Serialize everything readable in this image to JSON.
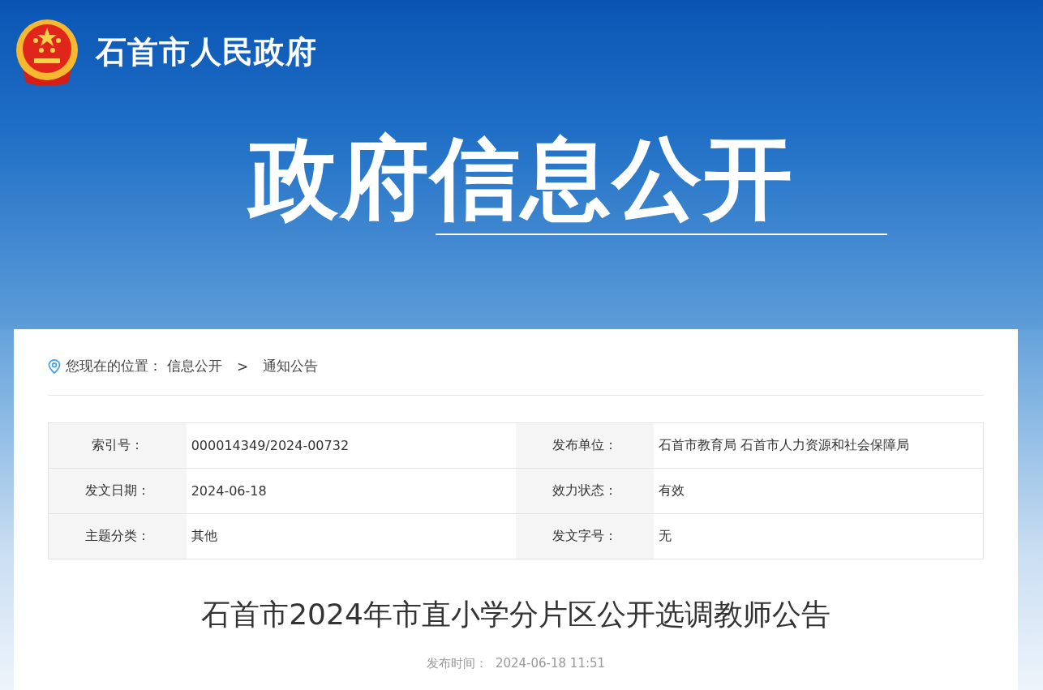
{
  "header": {
    "site_name": "石首市人民政府",
    "banner_title": "政府信息公开"
  },
  "breadcrumb": {
    "label": "您现在的位置：",
    "items": [
      "信息公开",
      "通知公告"
    ],
    "separator": ">"
  },
  "meta_table": {
    "rows": [
      {
        "cells": [
          {
            "label": "索引号：",
            "value": "000014349/2024-00732"
          },
          {
            "label": "发布单位：",
            "value": "石首市教育局 石首市人力资源和社会保障局"
          }
        ]
      },
      {
        "cells": [
          {
            "label": "发文日期：",
            "value": "2024-06-18"
          },
          {
            "label": "效力状态：",
            "value": "有效"
          }
        ]
      },
      {
        "cells": [
          {
            "label": "主题分类：",
            "value": "其他"
          },
          {
            "label": "发文字号：",
            "value": "无"
          }
        ]
      }
    ]
  },
  "article": {
    "title": "石首市2024年市直小学分片区公开选调教师公告",
    "publish_label": "发布时间：",
    "publish_time": "2024-06-18 11:51"
  }
}
